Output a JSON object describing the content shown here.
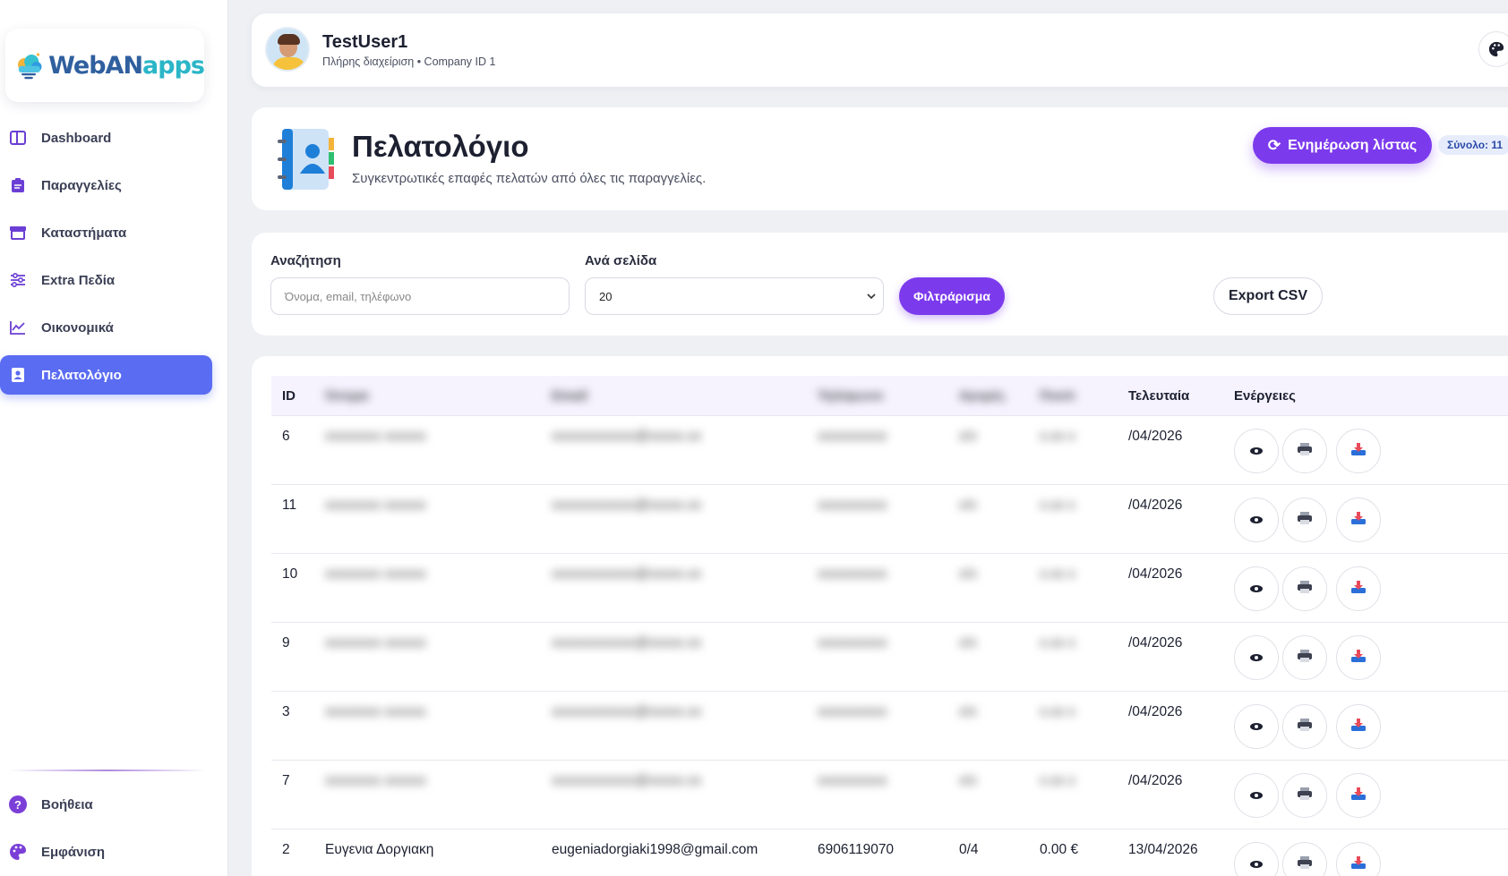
{
  "brand": {
    "logo_part1": "WebAN",
    "logo_part2": "apps"
  },
  "sidebar": {
    "items": [
      {
        "label": "Dashboard",
        "icon": "dashboard-icon"
      },
      {
        "label": "Παραγγελίες",
        "icon": "clipboard-icon"
      },
      {
        "label": "Καταστήματα",
        "icon": "store-icon"
      },
      {
        "label": "Extra Πεδία",
        "icon": "sliders-icon"
      },
      {
        "label": "Οικονομικά",
        "icon": "chart-line-icon"
      },
      {
        "label": "Πελατολόγιο",
        "icon": "contact-book-icon",
        "active": true
      }
    ],
    "bottom_items": [
      {
        "label": "Βοήθεια",
        "icon": "help-icon"
      },
      {
        "label": "Εμφάνιση",
        "icon": "palette-icon"
      }
    ]
  },
  "user": {
    "name": "TestUser1",
    "subtitle": "Πλήρης διαχείριση • Company ID 1"
  },
  "header": {
    "title": "Πελατολόγιο",
    "subtitle": "Συγκεντρωτικές επαφές πελατών από όλες τις παραγγελίες.",
    "refresh_label": "Ενημέρωση λίστας",
    "total_label": "Σύνολο: 11"
  },
  "filters": {
    "search_label": "Αναζήτηση",
    "search_placeholder": "Όνομα, email, τηλέφωνο",
    "per_page_label": "Ανά σελίδα",
    "per_page_value": "20",
    "filter_button": "Φιλτράρισμα",
    "export_button": "Export CSV"
  },
  "table": {
    "columns": [
      "ID",
      "Όνομα",
      "Email",
      "Τηλέφωνο",
      "Αγορές",
      "Ποσό",
      "Τελευταία",
      "Ενέργειες"
    ],
    "rows": [
      {
        "id": "6",
        "name": "",
        "email": "",
        "phone": "",
        "orders": "",
        "amount": "",
        "last": "/04/2026",
        "blurred": true
      },
      {
        "id": "11",
        "name": "",
        "email": "",
        "phone": "",
        "orders": "",
        "amount": "",
        "last": "/04/2026",
        "blurred": true
      },
      {
        "id": "10",
        "name": "",
        "email": "",
        "phone": "",
        "orders": "",
        "amount": "",
        "last": "/04/2026",
        "blurred": true
      },
      {
        "id": "9",
        "name": "",
        "email": "",
        "phone": "",
        "orders": "",
        "amount": "",
        "last": "/04/2026",
        "blurred": true
      },
      {
        "id": "3",
        "name": "",
        "email": "",
        "phone": "",
        "orders": "",
        "amount": "",
        "last": "/04/2026",
        "blurred": true
      },
      {
        "id": "7",
        "name": "",
        "email": "",
        "phone": "",
        "orders": "",
        "amount": "",
        "last": "/04/2026",
        "blurred": true
      },
      {
        "id": "2",
        "name": "Ευγενια Δοργιακη",
        "email": "eugeniadorgiaki1998@gmail.com",
        "phone": "6906119070",
        "orders": "0/4",
        "amount": "0.00 €",
        "last": "13/04/2026",
        "blurred": false
      }
    ],
    "actions": [
      "view-icon",
      "print-icon",
      "download-icon"
    ]
  },
  "colors": {
    "accent": "#7c3aed",
    "active_nav": "#5a6cf2",
    "background": "#eef0f4"
  }
}
